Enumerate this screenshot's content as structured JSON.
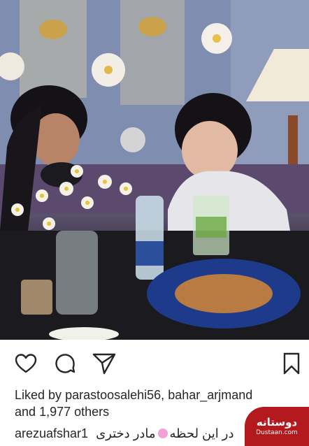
{
  "post": {
    "photo_alt": "",
    "likes": {
      "prefix": "Liked by",
      "user1": "parastoosalehi56",
      "sep": ",",
      "user2": "bahar_arjmand",
      "and": "and",
      "count": "1,977 others"
    },
    "caption": {
      "username": "arezuafshar1",
      "text": "در این لحظه",
      "text_tail": "مادر دختری"
    }
  },
  "icons": {
    "like": "heart-icon",
    "comment": "comment-icon",
    "share": "send-icon",
    "save": "bookmark-icon"
  },
  "watermark": {
    "title": "دوستانه",
    "url": "Dustaan.com"
  },
  "colors": {
    "text": "#262626",
    "watermark": "#b3191d"
  }
}
